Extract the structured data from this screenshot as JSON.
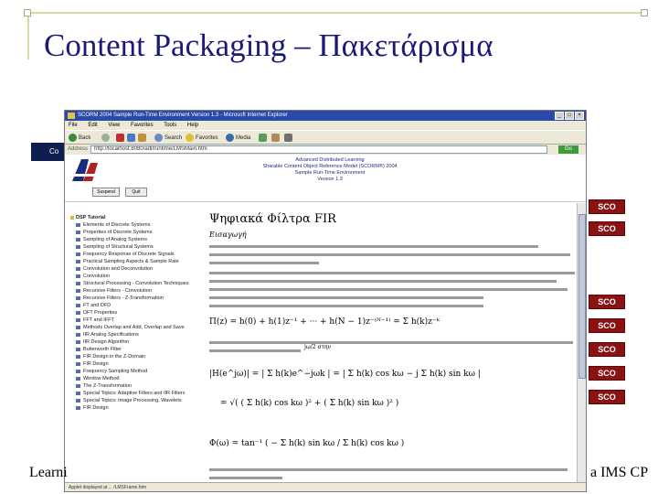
{
  "slide": {
    "title": "Content Packaging – Πακετάρισμα",
    "footer_left": "Learni",
    "footer_right": "a IMS CP"
  },
  "sco_badges": [
    "SCO",
    "SCO",
    "SCO",
    "SCO",
    "SCO",
    "SCO",
    "SCO"
  ],
  "behind_strip": {
    "text": "Co"
  },
  "browser": {
    "window_title": "SCORM 2004 Sample Run-Time Environment Version 1.3 - Microsoft Internet Explorer",
    "menu": [
      "File",
      "Edit",
      "View",
      "Favorites",
      "Tools",
      "Help"
    ],
    "toolbar": {
      "back": "Back",
      "search": "Search",
      "favorites": "Favorites",
      "media": "Media"
    },
    "address_label": "Address",
    "address_value": "http://localhost:8080/adl/runtime/LMSMain.htm",
    "go_label": "Go",
    "status_text": "Applet displayed at ... /LMSFrame.htm"
  },
  "adl": {
    "lines": [
      "Advanced Distributed Learning",
      "Sharable Content Object Reference Model (SCORM®) 2004",
      "Sample Run-Time Environment",
      "Version 1.3"
    ],
    "btn_suspend": "Suspend",
    "btn_quit": "Quit"
  },
  "toc": {
    "root": "DSP Tutorial",
    "items": [
      "Elements of Discrete Systems",
      "Properties of Discrete Systems",
      "Sampling of Analog Systems",
      "Sampling of Structural Systems",
      "Frequency Response of Discrete Signals",
      "Practical Sampling Aspects & Sample Rate",
      "Convolution and Deconvolution",
      "Convolution",
      "Structural Processing - Convolution Techniques",
      "Recursive Filters - Convolution",
      "Recursive Filters - Z-Transformation",
      "FT and DFD",
      "DFT Properties",
      "FFT and IFFT",
      "Methods Overlap and Add, Overlap and Save",
      "IIR Analog Specifications",
      "IIR Design Algorithm",
      "Butterworth Filter",
      "FIR Design in the Z-Domain",
      "FIR Design",
      "Frequency Sampling Method",
      "Window Method",
      "The Z-Transformation",
      "Special Topics: Adaptive Filters and IIR Filters",
      "Special Topics: Image Processing, Wavelets",
      "FIR Design"
    ]
  },
  "doc": {
    "title": "Ψηφιακά Φίλτρα FIR",
    "subtitle": "Εισαγωγή",
    "eq1": "Π(z) = h(0) + h(1)z⁻¹ + ··· + h(N − 1)z⁻⁽ᴺ⁻¹⁾ = Σ h(k)z⁻ᵏ",
    "eq2": "|H(e^jω)| = | Σ h(k)e^−jωk | = | Σ h(k) cos kω − j Σ h(k) sin kω |",
    "eq3": "= √( ( Σ h(k) cos kω )² + ( Σ h(k) sin kω )² )",
    "eq4": "Φ(ω) = tan⁻¹ ( − Σ h(k) sin kω / Σ h(k) cos kω )",
    "eq_fragment": "jω/2  στην"
  }
}
